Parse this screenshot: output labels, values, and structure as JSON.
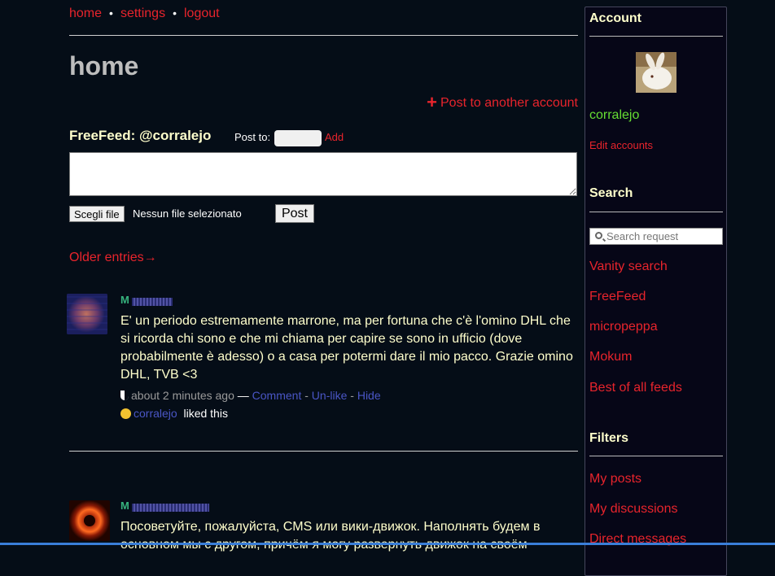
{
  "nav": {
    "home": "home",
    "settings": "settings",
    "logout": "logout",
    "dot": "•"
  },
  "page_title": "home",
  "post_another": {
    "plus": "+",
    "label": "Post to another account"
  },
  "composer": {
    "title": "FreeFeed: @corralejo",
    "post_to_label": "Post to:",
    "add_label": "Add",
    "file_button": "Scegli file",
    "file_status": "Nessun file selezionato",
    "post_button": "Post"
  },
  "older_entries": "Older entries→",
  "entries": [
    {
      "service_icon": "M",
      "body": "E' un periodo estremamente marrone, ma per fortuna che c'è l'omino DHL che si ricorda chi sono e che mi chiama per capire se sono in ufficio (dove probabilmente è adesso) o a casa per potermi dare il mio pacco. Grazie omino DHL, TVB <3",
      "time": "about 2 minutes ago",
      "dash": "—",
      "comment": "Comment",
      "unlike": "Un-like",
      "hide": "Hide",
      "sep": "-",
      "liker": "corralejo",
      "liked_text": "liked this"
    },
    {
      "service_icon": "M",
      "body": "Посоветуйте, пожалуйста, CMS или вики-движок. Наполнять будем в основном мы с другом, причём я могу развернуть движок на своём"
    }
  ],
  "sidebar": {
    "account_heading": "Account",
    "username": "corralejo",
    "edit_accounts": "Edit accounts",
    "search_heading": "Search",
    "search_placeholder": "Search request",
    "search_links": [
      "Vanity search",
      "FreeFeed",
      "micropeppa",
      "Mokum",
      "Best of all feeds"
    ],
    "filters_heading": "Filters",
    "filter_links": [
      "My posts",
      "My discussions",
      "Direct messages"
    ]
  },
  "colors": {
    "accent": "#e8242c",
    "background": "#050d17",
    "link_blue": "#4a56c6",
    "text_cream": "#ffffcc",
    "user_green": "#66dd33"
  }
}
